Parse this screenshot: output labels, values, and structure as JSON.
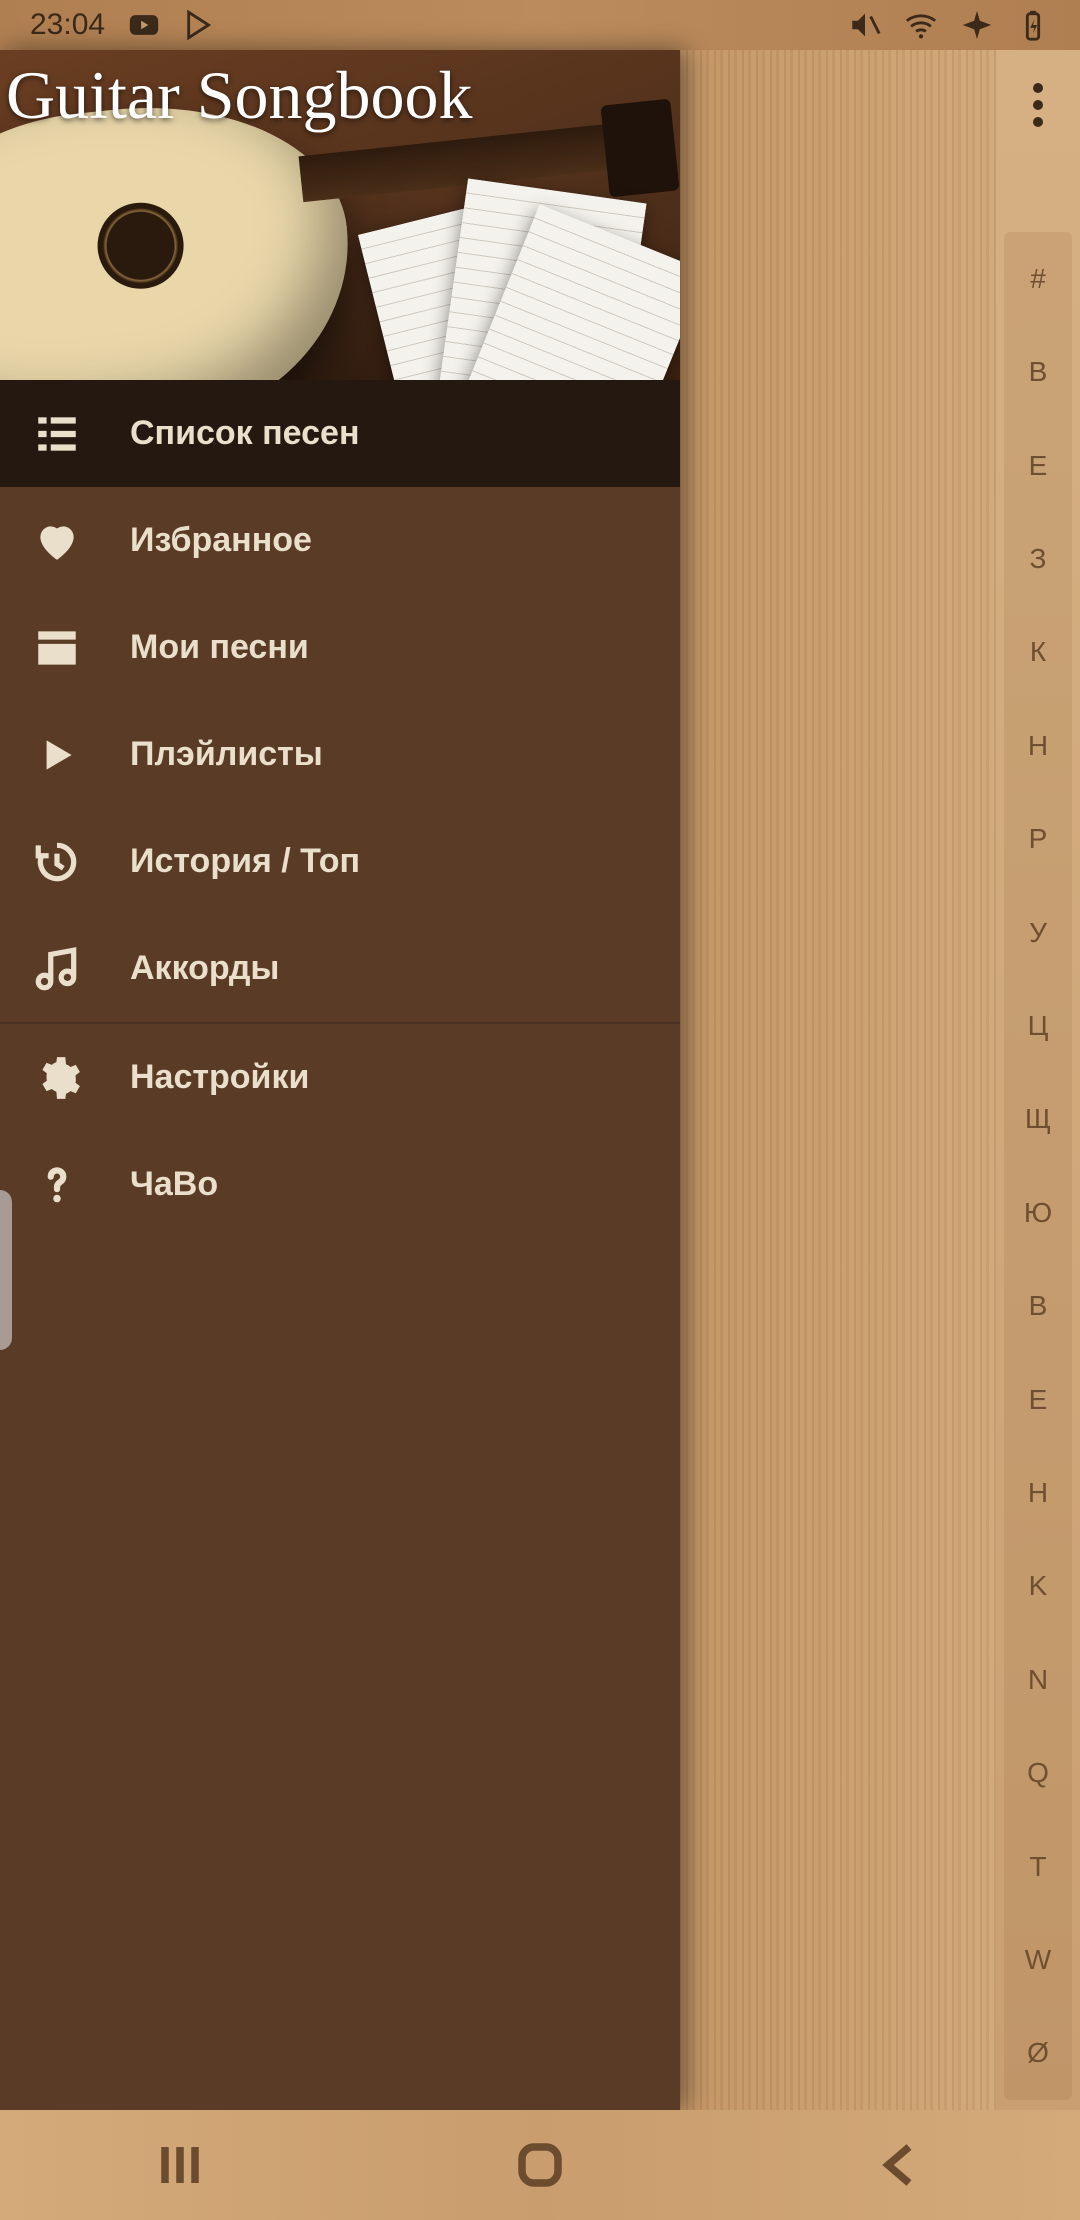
{
  "statusbar": {
    "time": "23:04"
  },
  "app": {
    "title": "Guitar Songbook"
  },
  "menu": {
    "items": [
      {
        "key": "songs",
        "label": "Список песен",
        "active": true
      },
      {
        "key": "favorites",
        "label": "Избранное",
        "active": false
      },
      {
        "key": "mysongs",
        "label": "Мои песни",
        "active": false
      },
      {
        "key": "playlists",
        "label": "Плэйлисты",
        "active": false
      },
      {
        "key": "history",
        "label": "История / Топ",
        "active": false
      },
      {
        "key": "chords",
        "label": "Аккорды",
        "active": false
      },
      {
        "key": "settings",
        "label": "Настройки",
        "active": false
      },
      {
        "key": "faq",
        "label": "ЧаВо",
        "active": false
      }
    ],
    "divider_after_index": 5
  },
  "alpha_index": [
    "#",
    "В",
    "Е",
    "З",
    "К",
    "Н",
    "Р",
    "У",
    "Ц",
    "Щ",
    "Ю",
    "B",
    "E",
    "H",
    "K",
    "N",
    "Q",
    "T",
    "W",
    "Ø"
  ]
}
